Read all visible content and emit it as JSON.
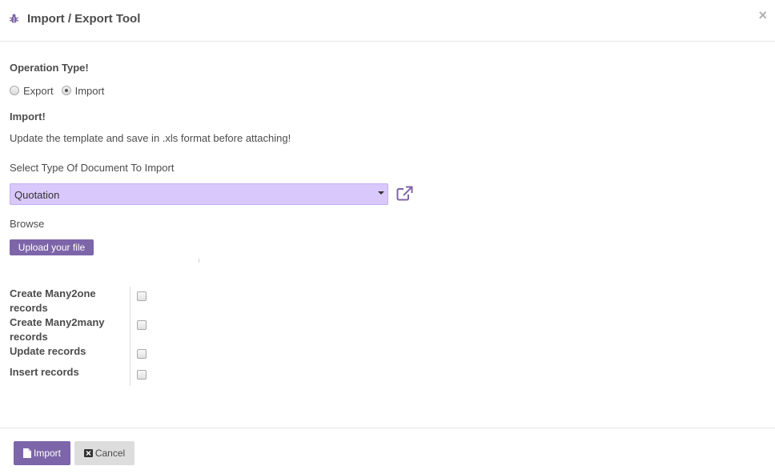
{
  "dialog": {
    "title": "Import / Export Tool",
    "close_label": "×",
    "icons": {
      "title_icon": "bug-icon",
      "close_icon": "close-icon"
    }
  },
  "operation": {
    "label": "Operation Type!",
    "options": [
      {
        "label": "Export",
        "checked": false
      },
      {
        "label": "Import",
        "checked": true
      }
    ]
  },
  "import_section": {
    "heading": "Import!",
    "instruction": "Update the template and save in .xls format before attaching!",
    "doc_type_label": "Select Type Of Document To Import",
    "doc_type_value": "Quotation",
    "external_link_icon": "external-link-icon",
    "browse_label": "Browse",
    "upload_button": "Upload your file"
  },
  "options": [
    {
      "label": "Create Many2one records",
      "checked": false
    },
    {
      "label": "Create Many2many records",
      "checked": false
    },
    {
      "label": "Update records",
      "checked": false
    },
    {
      "label": "Insert records",
      "checked": false
    }
  ],
  "footer": {
    "import_button": "Import",
    "cancel_button": "Cancel",
    "import_icon": "file-icon",
    "cancel_icon": "close-box-icon"
  },
  "colors": {
    "accent": "#7d65a9",
    "select_bg": "#d9c8fb"
  }
}
